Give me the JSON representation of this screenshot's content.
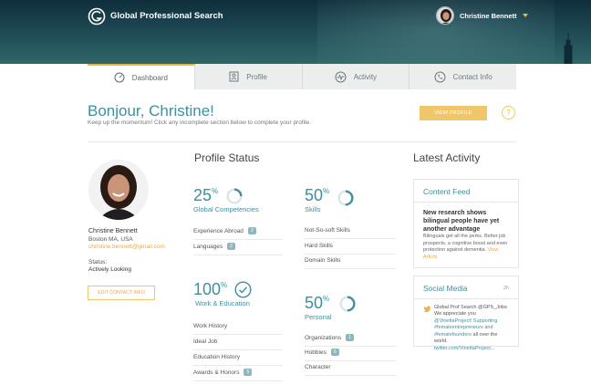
{
  "header": {
    "brand": "Global Professional Search",
    "user_name": "Christine Bennett"
  },
  "tabs": [
    {
      "label": "Dashboard",
      "icon": "dashboard-gauge-icon",
      "active": true
    },
    {
      "label": "Profile",
      "icon": "profile-card-icon",
      "active": false
    },
    {
      "label": "Activity",
      "icon": "activity-pulse-icon",
      "active": false
    },
    {
      "label": "Contact Info",
      "icon": "phone-icon",
      "active": false
    }
  ],
  "greeting": {
    "title": "Bonjour, Christine!",
    "subtitle": "Keep up the momentum! Click any incomplete section below to complete your profile.",
    "view_profile_label": "VIEW PROFILE",
    "help_label": "?"
  },
  "profile": {
    "name": "Christine Bennett",
    "location": "Boston MA, USA",
    "email": "christine.bennett@gmail.com",
    "status_label": "Status:",
    "status_value": "Actively Looking",
    "edit_label": "EDIT CONTACT INFO"
  },
  "profile_status": {
    "title": "Profile Status",
    "sections": [
      {
        "percent": "25",
        "percent_value": 25,
        "label": "Global Competencies",
        "items": [
          {
            "label": "Experience Abroad",
            "count": "2"
          },
          {
            "label": "Languages",
            "count": "2"
          }
        ]
      },
      {
        "percent": "50",
        "percent_value": 50,
        "label": "Skills",
        "items": [
          {
            "label": "Not-So-soft Skills",
            "count": ""
          },
          {
            "label": "Hard Skills",
            "count": ""
          },
          {
            "label": "Domain Skills",
            "count": ""
          }
        ]
      },
      {
        "percent": "100",
        "percent_value": 100,
        "label": "Work & Education",
        "items": [
          {
            "label": "Work History",
            "count": ""
          },
          {
            "label": "Ideal Job",
            "count": ""
          },
          {
            "label": "Education History",
            "count": ""
          },
          {
            "label": "Awards & Honors",
            "count": "5"
          }
        ]
      },
      {
        "percent": "50",
        "percent_value": 50,
        "label": "Personal",
        "items": [
          {
            "label": "Organizations",
            "count": "1"
          },
          {
            "label": "Hobbies",
            "count": "6"
          },
          {
            "label": "Character",
            "count": ""
          }
        ]
      }
    ],
    "percent_sign": "%"
  },
  "activity": {
    "title": "Latest Activity",
    "content_feed": {
      "heading": "Content Feed",
      "headline": "New research shows bilingual people have yet another advantage",
      "body": "Bilinguals get all the perks. Better job prospects, a cognitive boost and even protection against dementia.",
      "more": "View Article"
    },
    "social": {
      "heading": "Social Media",
      "time": "2h",
      "handle": "Global Prof Search @GPS_Jobs",
      "text_a": "We appreciate you ",
      "link_a": "@VinettaProject!",
      "link_b": "Supporting #femaleentrepreneurs and #femalefounders",
      "text_b": " all over the world.",
      "link_c": "twitter.com/VinettaProject..."
    }
  },
  "colors": {
    "accent": "#3f8fa0",
    "gold": "#f0c66a",
    "header": "#1d4753"
  }
}
